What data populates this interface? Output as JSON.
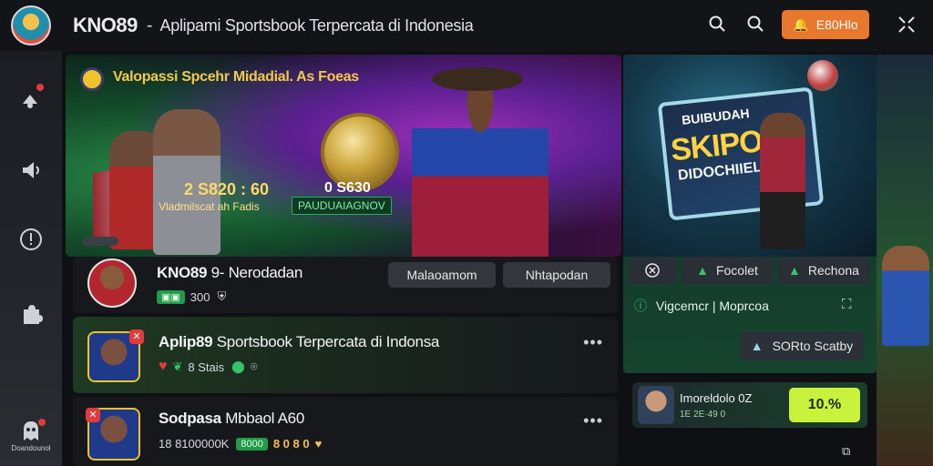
{
  "header": {
    "brand": "KNO89",
    "separator": "-",
    "subtitle": "Aplipami Sportsbook Terpercata di Indonesia",
    "login_label": "E80Hlo",
    "icons": [
      "search-icon",
      "search-icon",
      "bell-icon",
      "expand-icon"
    ]
  },
  "rail": {
    "icons": [
      "notification-icon",
      "speaker-icon",
      "alert-icon",
      "puzzle-icon",
      "ghost-icon"
    ],
    "bottom_label": "Doandounol"
  },
  "hero": {
    "title": "Valopassi Spcehr Midadial. As Foeas",
    "score": "2 S820 : 60",
    "score_sub": "Vladmilscat ah Fadis",
    "odds": "0 S630",
    "odds_label": "PAUDUAIAGNOV"
  },
  "side": {
    "shield_top": "BUIBUDAH",
    "shield_main": "SKIPON",
    "shield_sub": "DIDOCHIIEL",
    "pills": [
      {
        "icon": "close-circle-icon",
        "label": ""
      },
      {
        "icon": "ticket-icon",
        "label": "Focolet"
      },
      {
        "icon": "ticket-icon",
        "label": "Rechona"
      }
    ],
    "row_text": "Vigcemcr | Moprcoa",
    "button_label": "SORto Scatby"
  },
  "feed": [
    {
      "title_bold": "KNO89",
      "title_rest": "9- Nerodadan",
      "chip": "▣▣",
      "meta": "300",
      "buttons": [
        "Malaoamom",
        "Nhtapodan"
      ]
    },
    {
      "title_bold": "Aplip89",
      "title_rest": "Sportsbook Terpercata di Indonsa",
      "meta_prefix": "♥",
      "meta": "8 Stais",
      "more": "•••"
    },
    {
      "title_bold": "Sodpasa",
      "title_rest": "Mbbaol A60",
      "meta_prefix": "18 8100000K",
      "chip": "8000",
      "gold": "8 0 8 0",
      "more": "•••"
    }
  ],
  "oddcard": {
    "title": "Imoreldolo 0Z",
    "meta": "1E 2E·49 0",
    "value": "10.%"
  },
  "colors": {
    "accent": "#e8782d",
    "green": "#1f9b4a",
    "gold": "#f2c14e",
    "lime": "#c9f23c"
  }
}
